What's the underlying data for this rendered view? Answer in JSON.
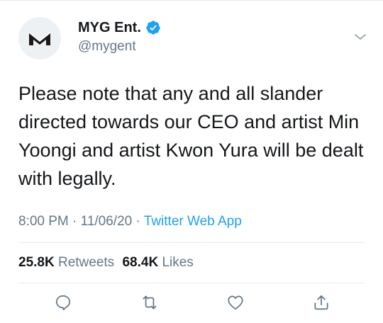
{
  "author": {
    "display_name": "MYG Ent.",
    "handle": "@mygent",
    "verified": true,
    "avatar_icon": "myg-logo",
    "brand_color": "#1a1a1a"
  },
  "tweet": {
    "text": "Please note that any and all slander directed towards our CEO and artist Min Yoongi and artist Kwon Yura will be dealt with legally.",
    "time": "8:00 PM",
    "date": "11/06/20",
    "separator": "·",
    "source": "Twitter Web App"
  },
  "stats": {
    "retweets_count": "25.8K",
    "retweets_label": "Retweets",
    "likes_count": "68.4K",
    "likes_label": "Likes"
  },
  "actions": [
    {
      "name": "reply",
      "icon": "comment-icon"
    },
    {
      "name": "retweet",
      "icon": "retweet-icon"
    },
    {
      "name": "like",
      "icon": "heart-icon"
    },
    {
      "name": "share",
      "icon": "share-icon"
    }
  ],
  "colors": {
    "accent": "#1da1f2",
    "secondary_text": "#657786",
    "primary_text": "#14171a",
    "divider": "#e6ecf0"
  }
}
